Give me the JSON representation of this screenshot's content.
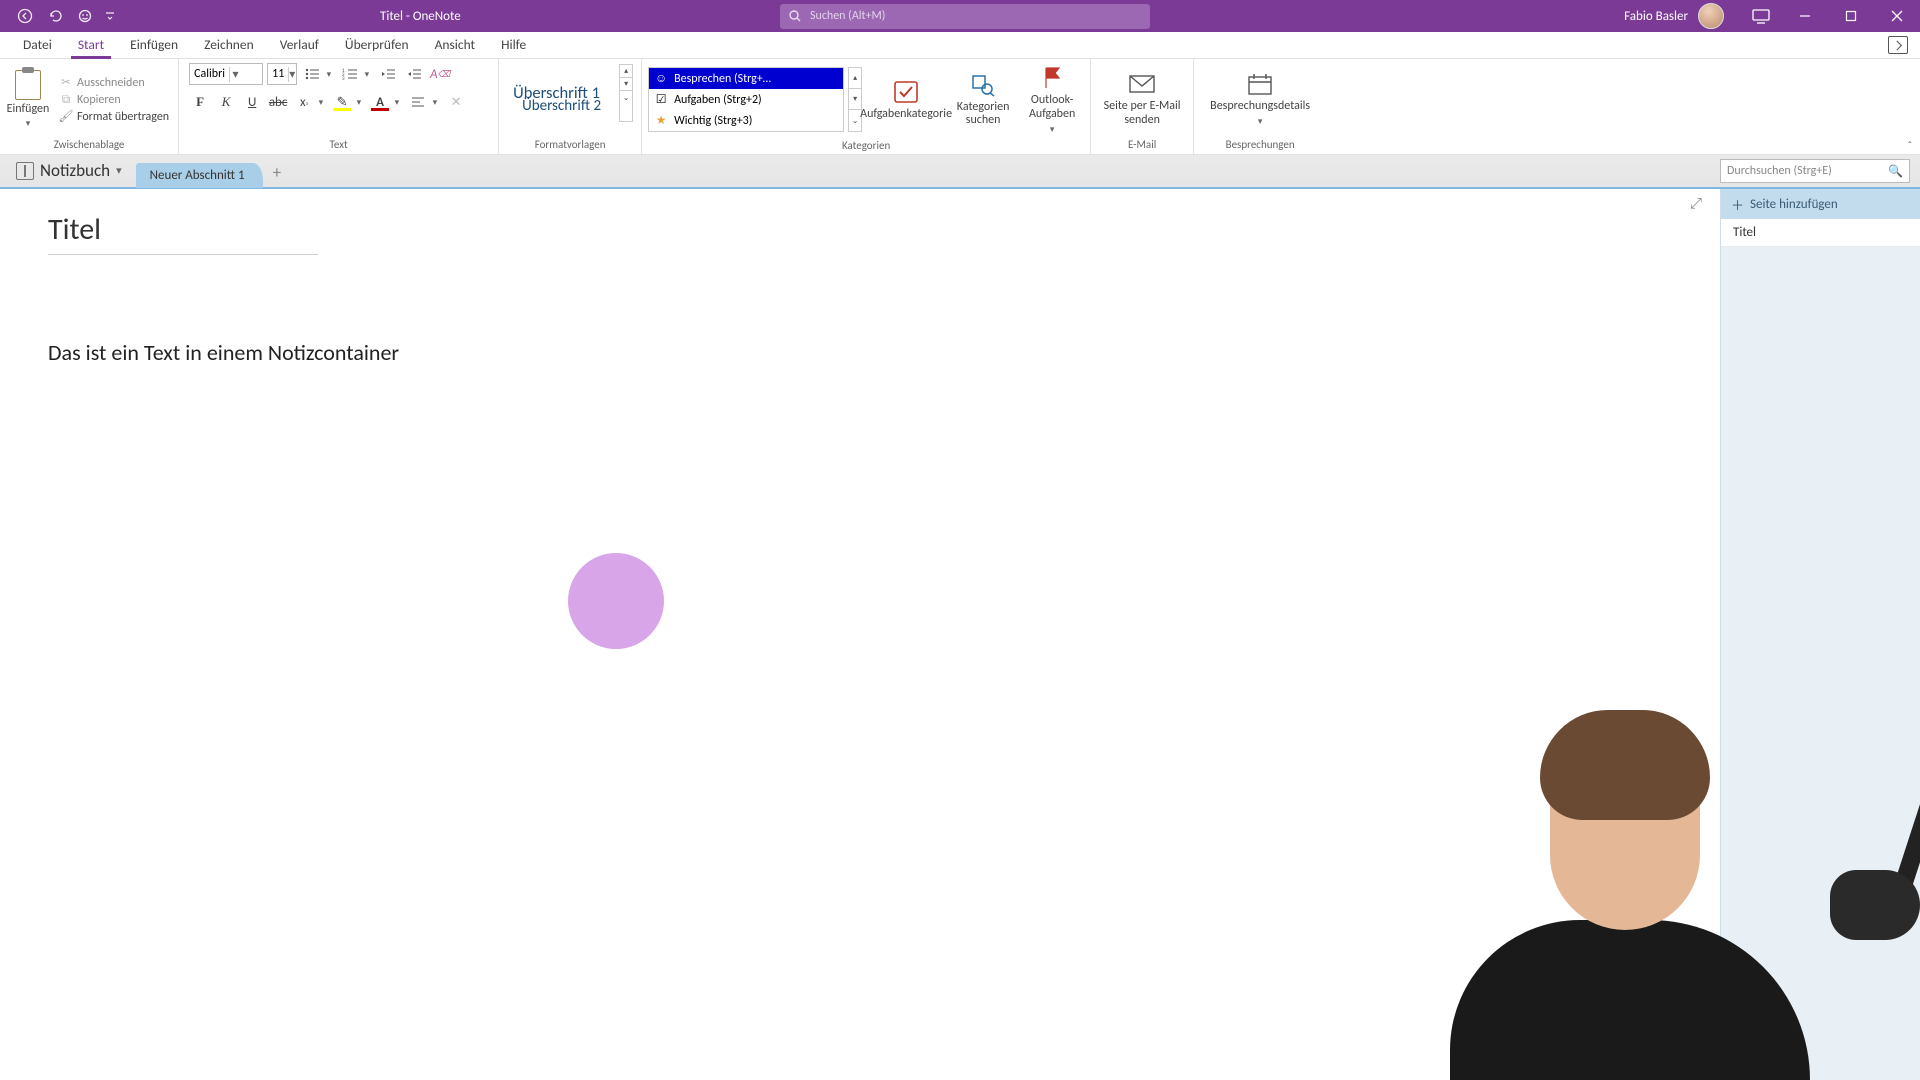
{
  "titlebar": {
    "app_title": "Titel  -  OneNote",
    "user_name": "Fabio Basler"
  },
  "search": {
    "placeholder": "Suchen (Alt+M)"
  },
  "tabs": {
    "datei": "Datei",
    "start": "Start",
    "einfuegen": "Einfügen",
    "zeichnen": "Zeichnen",
    "verlauf": "Verlauf",
    "ueberpruefen": "Überprüfen",
    "ansicht": "Ansicht",
    "hilfe": "Hilfe"
  },
  "ribbon": {
    "clipboard": {
      "paste": "Einfügen",
      "cut": "Ausschneiden",
      "copy": "Kopieren",
      "format_painter": "Format übertragen",
      "label": "Zwischenablage"
    },
    "text": {
      "font_name": "Calibri",
      "font_size": "11",
      "label": "Text"
    },
    "styles": {
      "h1": "Überschrift 1",
      "h2": "Überschrift 2",
      "label": "Formatvorlagen"
    },
    "tags": {
      "t1": "Besprechen (Strg+…",
      "t2": "Aufgaben (Strg+2)",
      "t3": "Wichtig (Strg+3)",
      "task_cat": "Aufgabenkategorie",
      "find_cat": "Kategorien suchen",
      "outlook": "Outlook-Aufgaben",
      "label": "Kategorien"
    },
    "email": {
      "send": "Seite per E-Mail senden",
      "label": "E-Mail"
    },
    "meetings": {
      "details": "Besprechungsdetails",
      "label": "Besprechungen"
    }
  },
  "notebook": {
    "name": "Notizbuch",
    "section": "Neuer Abschnitt 1",
    "search_placeholder": "Durchsuchen (Strg+E)"
  },
  "pagelist": {
    "add": "Seite hinzufügen",
    "item1": "Titel"
  },
  "page": {
    "title": "Titel",
    "body": "Das ist ein Text in einem Notizcontainer"
  }
}
